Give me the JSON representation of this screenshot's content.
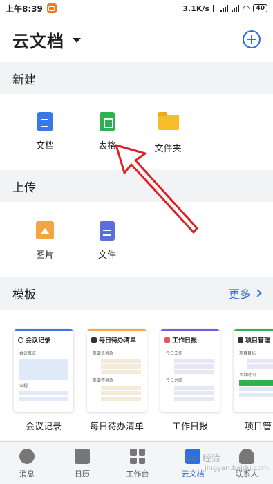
{
  "status_bar": {
    "time": "上午8:39",
    "network_speed": "3.1K/s",
    "battery": "40"
  },
  "header": {
    "title": "云文档"
  },
  "sections": {
    "new": {
      "title": "新建",
      "items": [
        {
          "label": "文档",
          "icon": "doc-icon"
        },
        {
          "label": "表格",
          "icon": "sheet-icon"
        },
        {
          "label": "文件夹",
          "icon": "folder-icon"
        }
      ]
    },
    "upload": {
      "title": "上传",
      "items": [
        {
          "label": "图片",
          "icon": "image-icon"
        },
        {
          "label": "文件",
          "icon": "file-icon"
        }
      ]
    },
    "templates": {
      "title": "模板",
      "more_label": "更多",
      "items": [
        {
          "label": "会议记录",
          "card_title": "会议记录",
          "accent": "#3b78e7",
          "line1": "会议概览",
          "line2": "议程"
        },
        {
          "label": "每日待办清单",
          "card_title": "每日待办清单",
          "accent": "#f3a443",
          "line1": "重要且紧急",
          "line2": "重要不紧急"
        },
        {
          "label": "工作日报",
          "card_title": "工作日报",
          "accent": "#7b5be1",
          "line1": "今日工作",
          "line2": "今日总结"
        },
        {
          "label": "项目管",
          "card_title": "项目管理",
          "accent": "#2eb14e",
          "line1": "项目目标",
          "line2": "项目时间"
        }
      ]
    }
  },
  "tab_bar": {
    "items": [
      {
        "label": "消息",
        "active": false
      },
      {
        "label": "日历",
        "active": false
      },
      {
        "label": "工作台",
        "active": false
      },
      {
        "label": "云文档",
        "active": true
      },
      {
        "label": "联系人",
        "active": false
      }
    ]
  },
  "watermark": {
    "text": "Bai 经验",
    "url_text": "jingyan.baidu.com"
  },
  "colors": {
    "accent": "#2f6de1",
    "annotation_arrow": "#e02020"
  }
}
